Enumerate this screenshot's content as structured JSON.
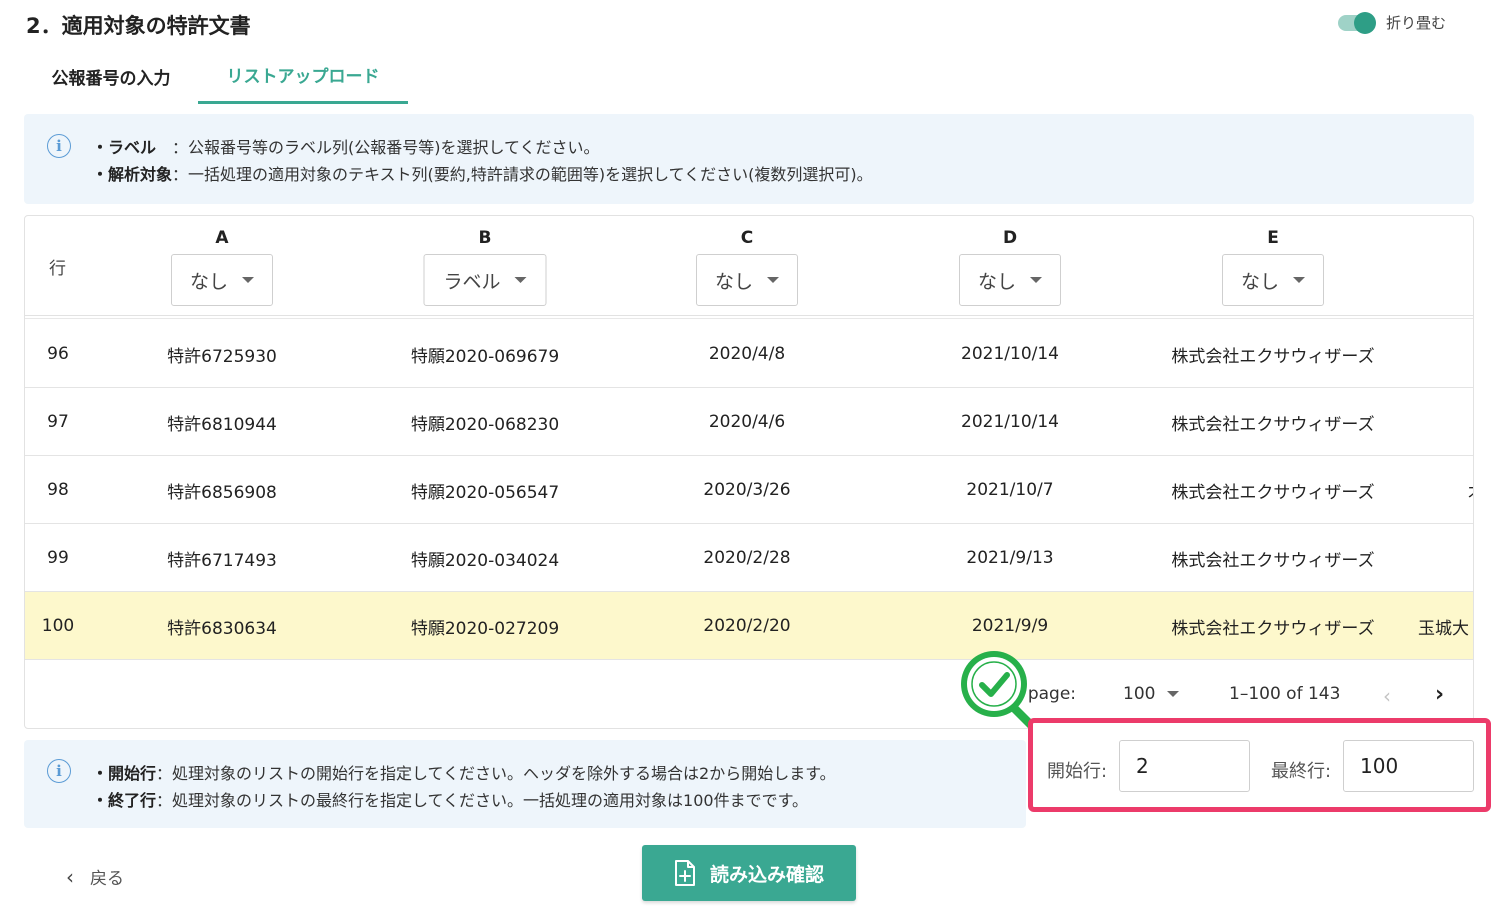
{
  "section": {
    "title": "2．適用対象の特許文書",
    "toggle_label": "折り畳む"
  },
  "tabs": [
    {
      "label": "公報番号の入力"
    },
    {
      "label": "リストアップロード"
    }
  ],
  "info_top": {
    "line1_key": "・ラベル　",
    "line1_text": "：公報番号等のラベル列(公報番号等)を選択してください。",
    "line2_key": "・解析対象",
    "line2_text": "：一括処理の適用対象のテキスト列(要約,特許請求の範囲等)を選択してください(複数列選択可)。"
  },
  "table": {
    "row_header": "行",
    "columns": [
      {
        "letter": "A",
        "select": "なし"
      },
      {
        "letter": "B",
        "select": "ラベル"
      },
      {
        "letter": "C",
        "select": "なし"
      },
      {
        "letter": "D",
        "select": "なし"
      },
      {
        "letter": "E",
        "select": "なし"
      }
    ],
    "rows": [
      {
        "num": "96",
        "a": "特許6725930",
        "b": "特願2020-069679",
        "c": "2020/4/8",
        "d": "2021/10/14",
        "e": "株式会社エクサウィザーズ",
        "f": ""
      },
      {
        "num": "97",
        "a": "特許6810944",
        "b": "特願2020-068230",
        "c": "2020/4/6",
        "d": "2021/10/14",
        "e": "株式会社エクサウィザーズ",
        "f": ""
      },
      {
        "num": "98",
        "a": "特許6856908",
        "b": "特願2020-056547",
        "c": "2020/3/26",
        "d": "2021/10/7",
        "e": "株式会社エクサウィザーズ",
        "f": "才"
      },
      {
        "num": "99",
        "a": "特許6717493",
        "b": "特願2020-034024",
        "c": "2020/2/28",
        "d": "2021/9/13",
        "e": "株式会社エクサウィザーズ",
        "f": ""
      },
      {
        "num": "100",
        "a": "特許6830634",
        "b": "特願2020-027209",
        "c": "2020/2/20",
        "d": "2021/9/9",
        "e": "株式会社エクサウィザーズ",
        "f": "玉城大"
      }
    ]
  },
  "pager": {
    "per_page_label": "er page:",
    "per_page_value": "100",
    "range": "1–100 of 143"
  },
  "info_bottom": {
    "line1_key": "・開始行",
    "line1_text": "：処理対象のリストの開始行を指定してください。ヘッダを除外する場合は2から開始します。",
    "line2_key": "・終了行",
    "line2_text": "：処理対象のリストの最終行を指定してください。一括処理の適用対象は100件までです。"
  },
  "range": {
    "start_label": "開始行:",
    "start_value": "2",
    "end_label": "最終行:",
    "end_value": "100"
  },
  "footer": {
    "back_label": "戻る",
    "confirm_label": "読み込み確認"
  },
  "colors": {
    "accent": "#3aa892",
    "highlight_row": "#fdf8cc",
    "annotation_border": "#ec3b6a",
    "badge_green": "#27b04a"
  }
}
